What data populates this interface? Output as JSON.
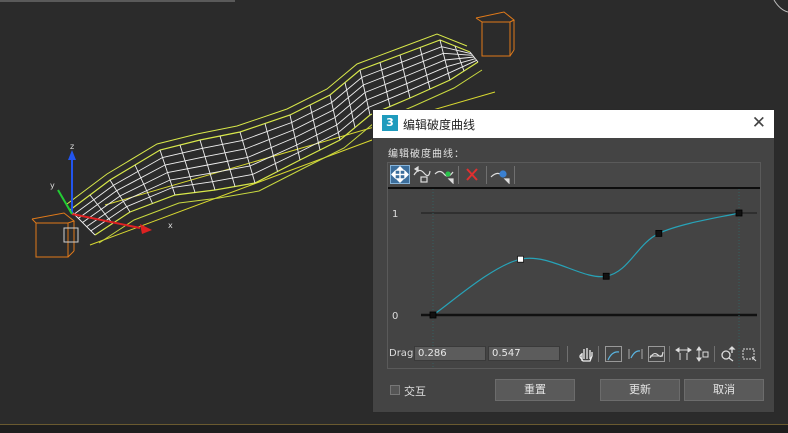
{
  "dialog": {
    "title": "编辑破度曲线",
    "curve_label": "编辑破度曲线：",
    "drag_label": "Drag",
    "value1": "0.286",
    "value2": "0.547",
    "interactive_label": "交互",
    "reset_label": "重置",
    "update_label": "更新",
    "cancel_label": "取消",
    "app_icon_text": "3"
  },
  "curve_data": {
    "y_axis_labels": [
      "1",
      "0"
    ],
    "points": [
      {
        "t": 0.0,
        "v": 0.0
      },
      {
        "t": 0.286,
        "v": 0.547
      },
      {
        "t": 0.566,
        "v": 0.38
      },
      {
        "t": 0.738,
        "v": 0.8
      },
      {
        "t": 1.0,
        "v": 1.0
      }
    ],
    "curve_color": "#27a3b8"
  },
  "colors": {
    "viewport_bg": "#2b2b2b",
    "wireframe": "#d8e84a",
    "gizmo_box": "#e07a1a",
    "active_btn": "#3c6e9c"
  },
  "icons": {
    "move": "move-keys-icon",
    "scale": "scale-keys-icon",
    "add_point": "add-point-icon",
    "delete": "delete-point-icon",
    "bezier": "bezier-corner-icon",
    "pan": "pan-hand-icon",
    "zoom_extents": "zoom-extents-icon",
    "zoom_h": "zoom-horizontal-icon",
    "zoom_v": "zoom-vertical-icon",
    "zoom": "zoom-icon",
    "zoom_region": "zoom-region-icon"
  }
}
